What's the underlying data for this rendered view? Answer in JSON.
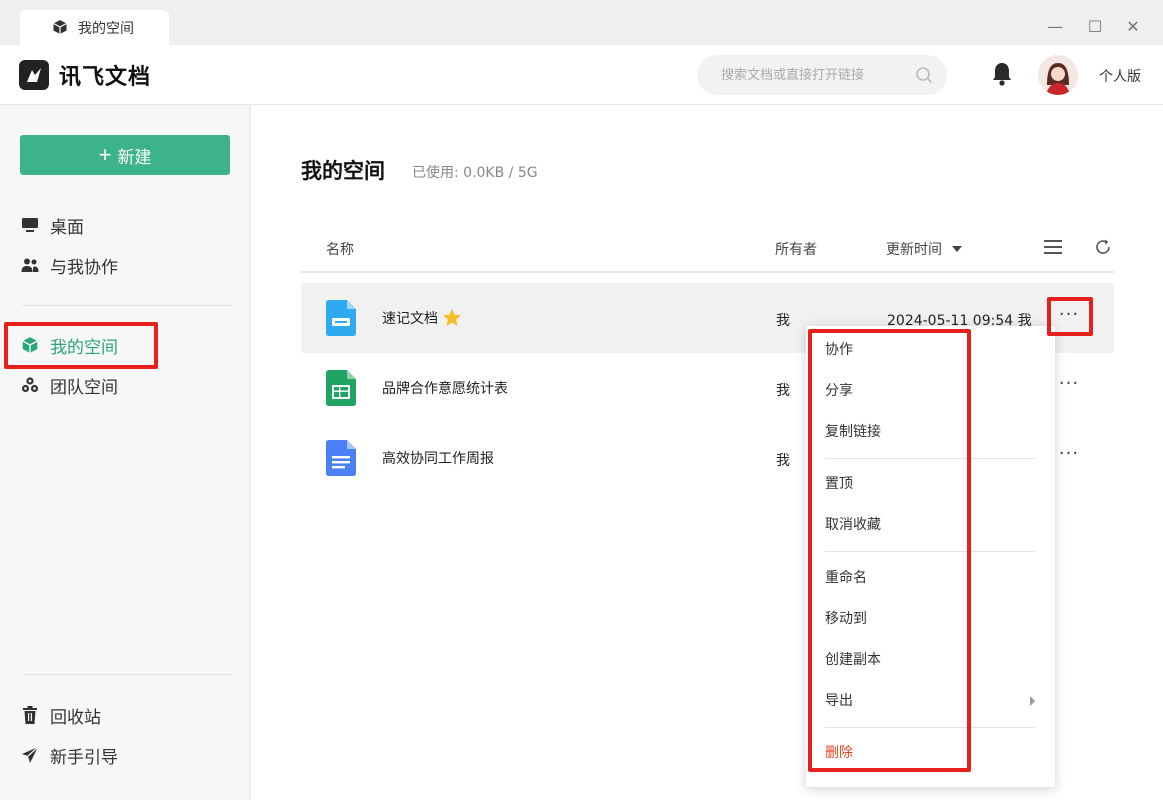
{
  "window": {
    "tab_title": "我的空间",
    "tab_icon": "cube-icon",
    "controls": [
      "—",
      "☐",
      "✕"
    ]
  },
  "header": {
    "logo_text": "讯飞文档",
    "search_placeholder": "搜索文档或直接打开链接",
    "edition": "个人版"
  },
  "sidebar": {
    "new_button": "新建",
    "items": [
      {
        "label": "桌面",
        "icon": "desktop-icon"
      },
      {
        "label": "与我协作",
        "icon": "users-icon"
      },
      {
        "label": "我的空间",
        "icon": "cube-icon",
        "active": true
      },
      {
        "label": "团队空间",
        "icon": "team-icon"
      }
    ],
    "bottom_items": [
      {
        "label": "回收站",
        "icon": "trash-icon"
      },
      {
        "label": "新手引导",
        "icon": "send-icon"
      }
    ]
  },
  "main": {
    "title": "我的空间",
    "usage": "已使用:  0.0KB  /  5G",
    "columns": {
      "name": "名称",
      "owner": "所有者",
      "updated": "更新时间"
    },
    "files": [
      {
        "name": "速记文档",
        "owner": "我",
        "updated": "2024-05-11 09:54 我",
        "icon": "note-doc-icon",
        "starred": true
      },
      {
        "name": "品牌合作意愿统计表",
        "owner": "我",
        "updated": "",
        "icon": "sheet-icon",
        "starred": false
      },
      {
        "name": "高效协同工作周报",
        "owner": "我",
        "updated": "",
        "icon": "doc-icon",
        "starred": false
      }
    ]
  },
  "context_menu": {
    "items": [
      "协作",
      "分享",
      "复制链接",
      "置顶",
      "取消收藏",
      "重命名",
      "移动到",
      "创建副本",
      "导出",
      "删除"
    ]
  },
  "colors": {
    "brand": "#3db38a",
    "highlight_box": "#e8201c",
    "danger": "#e8441c"
  }
}
